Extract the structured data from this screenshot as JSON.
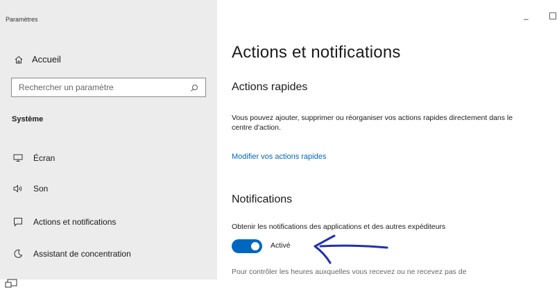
{
  "window": {
    "title": "Paramètres",
    "minimize_glyph": "–"
  },
  "sidebar": {
    "home_label": "Accueil",
    "search_placeholder": "Rechercher un paramètre",
    "section_label": "Système",
    "items": [
      {
        "label": "Écran",
        "icon": "monitor-icon"
      },
      {
        "label": "Son",
        "icon": "speaker-icon"
      },
      {
        "label": "Actions et notifications",
        "icon": "notification-icon"
      },
      {
        "label": "Assistant de concentration",
        "icon": "moon-icon"
      }
    ]
  },
  "main": {
    "title": "Actions et notifications",
    "quick_actions": {
      "heading": "Actions rapides",
      "description": "Vous pouvez ajouter, supprimer ou réorganiser vos actions rapides directement dans le centre d'action.",
      "link": "Modifier vos actions rapides"
    },
    "notifications": {
      "heading": "Notifications",
      "toggle_description": "Obtenir les notifications des applications et des autres expéditeurs",
      "toggle_state": "Activé",
      "footer_text": "Pour contrôler les heures auxquelles vous recevez ou ne recevez pas de"
    }
  },
  "colors": {
    "accent": "#0067c0",
    "sidebar_bg": "#ececec",
    "annotation_arrow": "#1f2fb5"
  }
}
